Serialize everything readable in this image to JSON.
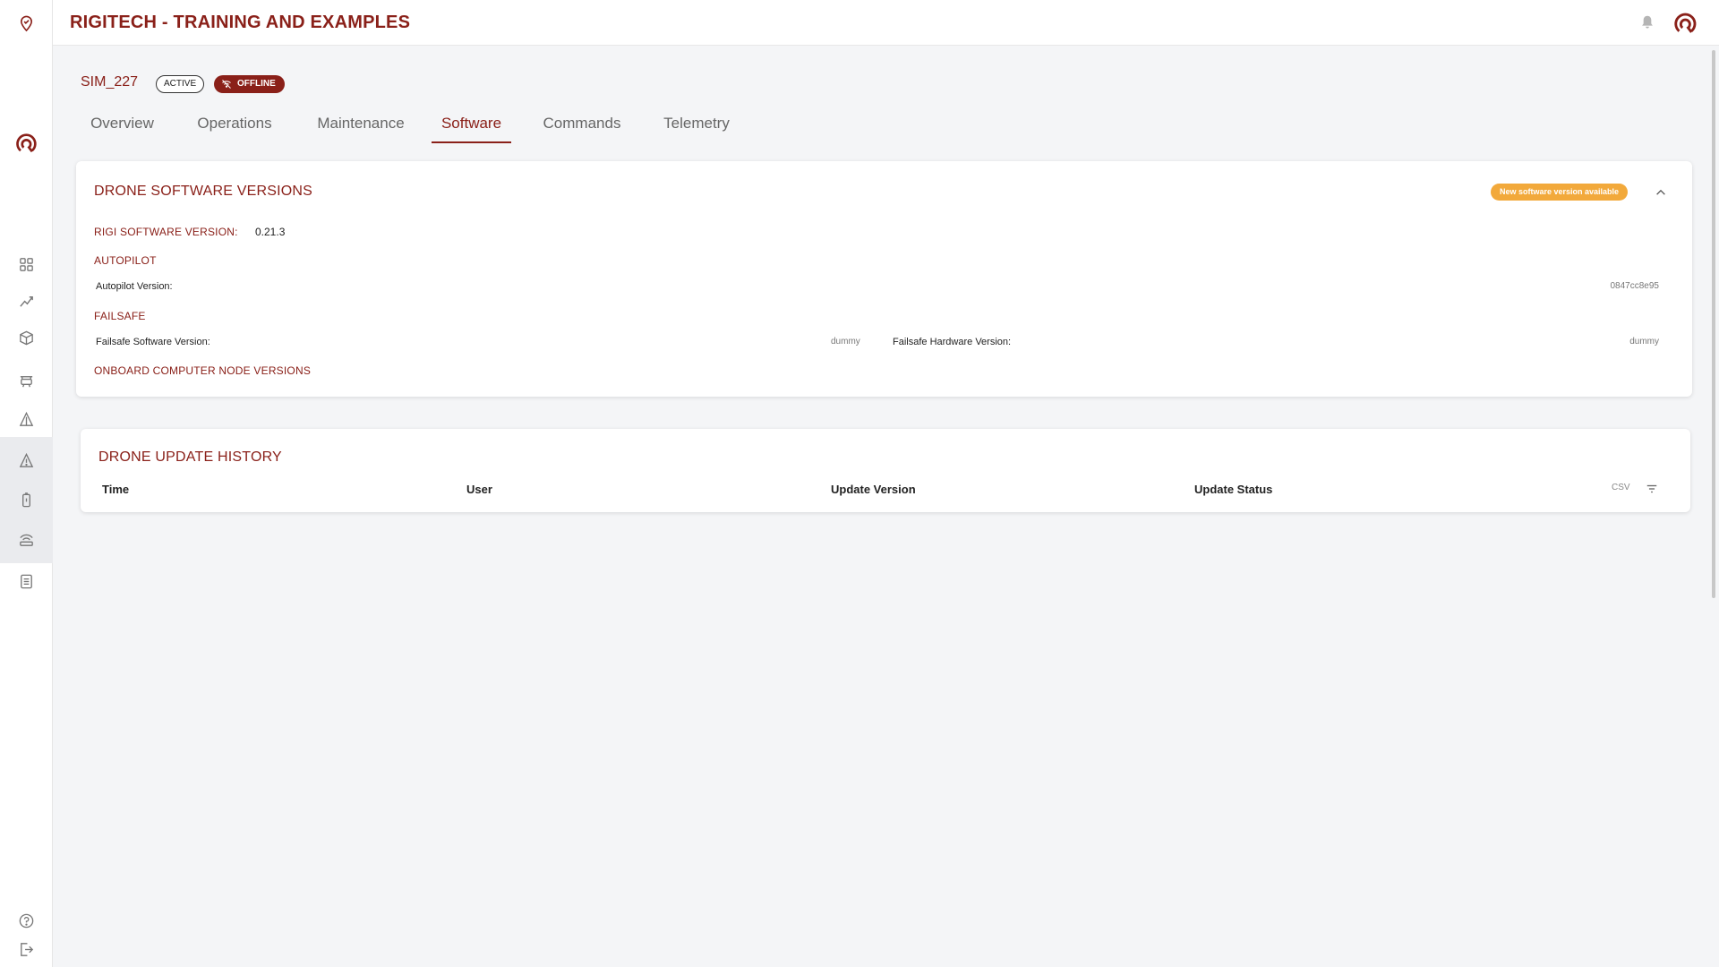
{
  "header": {
    "app_title": "RIGITECH - TRAINING AND EXAMPLES"
  },
  "sidebar": {
    "items": [
      {
        "icon": "location-pin-icon"
      },
      {
        "icon": "rigitech-logo-icon"
      },
      {
        "icon": "dashboard-grid-icon"
      },
      {
        "icon": "analytics-chart-icon"
      },
      {
        "icon": "package-box-icon"
      },
      {
        "icon": "drone-icon"
      },
      {
        "icon": "airspace-triangle-icon"
      },
      {
        "icon": "warning-triangle-icon"
      },
      {
        "icon": "battery-icon"
      },
      {
        "icon": "ground-station-icon"
      },
      {
        "icon": "document-icon"
      },
      {
        "icon": "help-icon"
      },
      {
        "icon": "logout-icon"
      }
    ]
  },
  "drone": {
    "name": "SIM_227",
    "status_badge": "ACTIVE",
    "connection_badge": "OFFLINE"
  },
  "tabs": [
    {
      "label": "Overview"
    },
    {
      "label": "Operations"
    },
    {
      "label": "Maintenance"
    },
    {
      "label": "Software",
      "active": true
    },
    {
      "label": "Commands"
    },
    {
      "label": "Telemetry"
    }
  ],
  "software_card": {
    "title": "DRONE SOFTWARE VERSIONS",
    "new_version_pill": "New software version available",
    "rigi_label": "RIGI SOFTWARE VERSION:",
    "rigi_value": "0.21.3",
    "autopilot_section": "AUTOPILOT",
    "autopilot_label": "Autopilot Version:",
    "autopilot_value": "0847cc8e95",
    "failsafe_section": "FAILSAFE",
    "failsafe_sw_label": "Failsafe Software Version:",
    "failsafe_sw_value": "dummy",
    "failsafe_hw_label": "Failsafe Hardware Version:",
    "failsafe_hw_value": "dummy",
    "onboard_section": "ONBOARD COMPUTER NODE VERSIONS"
  },
  "history_card": {
    "title": "DRONE UPDATE HISTORY",
    "columns": [
      "Time",
      "User",
      "Update Version",
      "Update Status"
    ],
    "csv_label": "CSV"
  },
  "colors": {
    "brand": "#8a2019",
    "warning": "#f2a93b",
    "background": "#f4f5f7"
  }
}
